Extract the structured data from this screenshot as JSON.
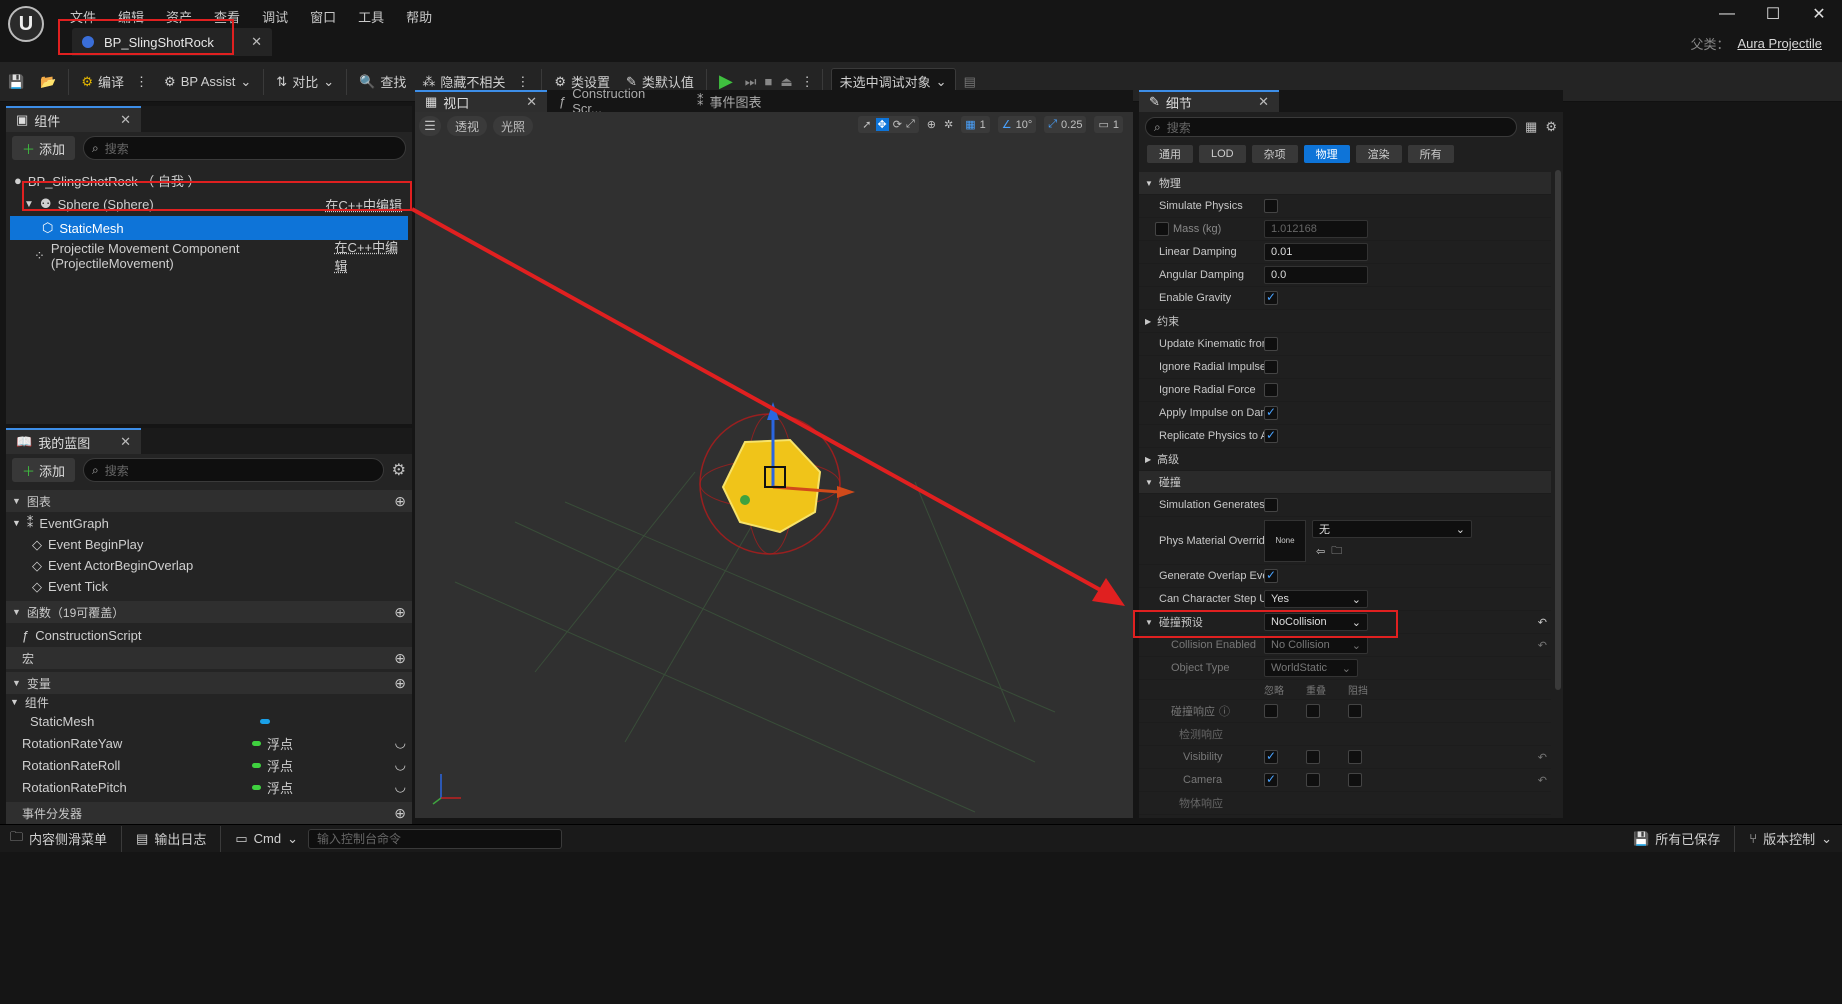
{
  "menu": [
    "文件",
    "编辑",
    "资产",
    "查看",
    "调试",
    "窗口",
    "工具",
    "帮助"
  ],
  "tab_title": "BP_SlingShotRock",
  "parent_label": "父类：",
  "parent_value": "Aura Projectile",
  "toolbar": {
    "compile": "编译",
    "bp_assist": "BP Assist",
    "diff": "对比",
    "find": "查找",
    "hide_unrelated": "隐藏不相关",
    "class_settings": "类设置",
    "class_defaults": "类默认值",
    "debug_target": "未选中调试对象"
  },
  "components": {
    "tab": "组件",
    "add": "添加",
    "search_placeholder": "搜索",
    "root": "BP_SlingShotRock （ 自我 ）",
    "sphere": "Sphere (Sphere)",
    "sphere_link": "在C++中编辑",
    "static_mesh": "StaticMesh",
    "projectile": "Projectile Movement Component (ProjectileMovement)",
    "projectile_link": "在C++中编辑"
  },
  "viewport": {
    "tab": "视口",
    "tab2": "Construction Scr...",
    "tab3": "事件图表",
    "perspective": "透视",
    "lit": "光照",
    "grid": "1",
    "angle": "10°",
    "scale": "0.25",
    "camera": "1"
  },
  "my_bp": {
    "tab": "我的蓝图",
    "add": "添加",
    "search_placeholder": "搜索",
    "graphs": "图表",
    "event_graph": "EventGraph",
    "events": [
      "Event BeginPlay",
      "Event ActorBeginOverlap",
      "Event Tick"
    ],
    "functions": "函数（19可覆盖）",
    "construction": "ConstructionScript",
    "macros": "宏",
    "variables": "变量",
    "components": "组件",
    "static_mesh": "StaticMesh",
    "vars": [
      {
        "name": "RotationRateYaw",
        "type": "浮点"
      },
      {
        "name": "RotationRateRoll",
        "type": "浮点"
      },
      {
        "name": "RotationRatePitch",
        "type": "浮点"
      }
    ],
    "dispatchers": "事件分发器"
  },
  "details": {
    "tab": "细节",
    "search_placeholder": "搜索",
    "tabs": [
      "通用",
      "LOD",
      "杂项",
      "物理",
      "渲染",
      "所有"
    ],
    "active_tab": "物理",
    "cat_physics": "物理",
    "simulate": "Simulate Physics",
    "mass": "Mass (kg)",
    "mass_val": "1.012168",
    "linear": "Linear Damping",
    "linear_val": "0.01",
    "angular": "Angular Damping",
    "angular_val": "0.0",
    "gravity": "Enable Gravity",
    "constraints": "约束",
    "kinematic": "Update Kinematic from...",
    "radial_impulse": "Ignore Radial Impulse",
    "radial_force": "Ignore Radial Force",
    "apply_impulse": "Apply Impulse on Damage",
    "replicate": "Replicate Physics to Aut...",
    "advanced": "高级",
    "cat_collision": "碰撞",
    "sim_hits": "Simulation Generates Hi...",
    "phys_mat": "Phys Material Override",
    "phys_mat_thumb": "None",
    "phys_mat_val": "无",
    "overlap": "Generate Overlap Events",
    "step_up": "Can Character Step Up On",
    "step_up_val": "Yes",
    "preset": "碰撞预设",
    "preset_val": "NoCollision",
    "coll_enabled": "Collision Enabled",
    "coll_enabled_val": "No Collision",
    "obj_type": "Object Type",
    "obj_type_val": "WorldStatic",
    "ignore": "忽略",
    "overlap_h": "重叠",
    "block": "阻挡",
    "coll_resp": "碰撞响应",
    "trace_resp": "检测响应",
    "visibility": "Visibility",
    "camera": "Camera",
    "obj_resp": "物体响应"
  },
  "status": {
    "drawer": "内容侧滑菜单",
    "output": "输出日志",
    "cmd": "Cmd",
    "cmd_placeholder": "输入控制台命令",
    "saved": "所有已保存",
    "vc": "版本控制"
  }
}
